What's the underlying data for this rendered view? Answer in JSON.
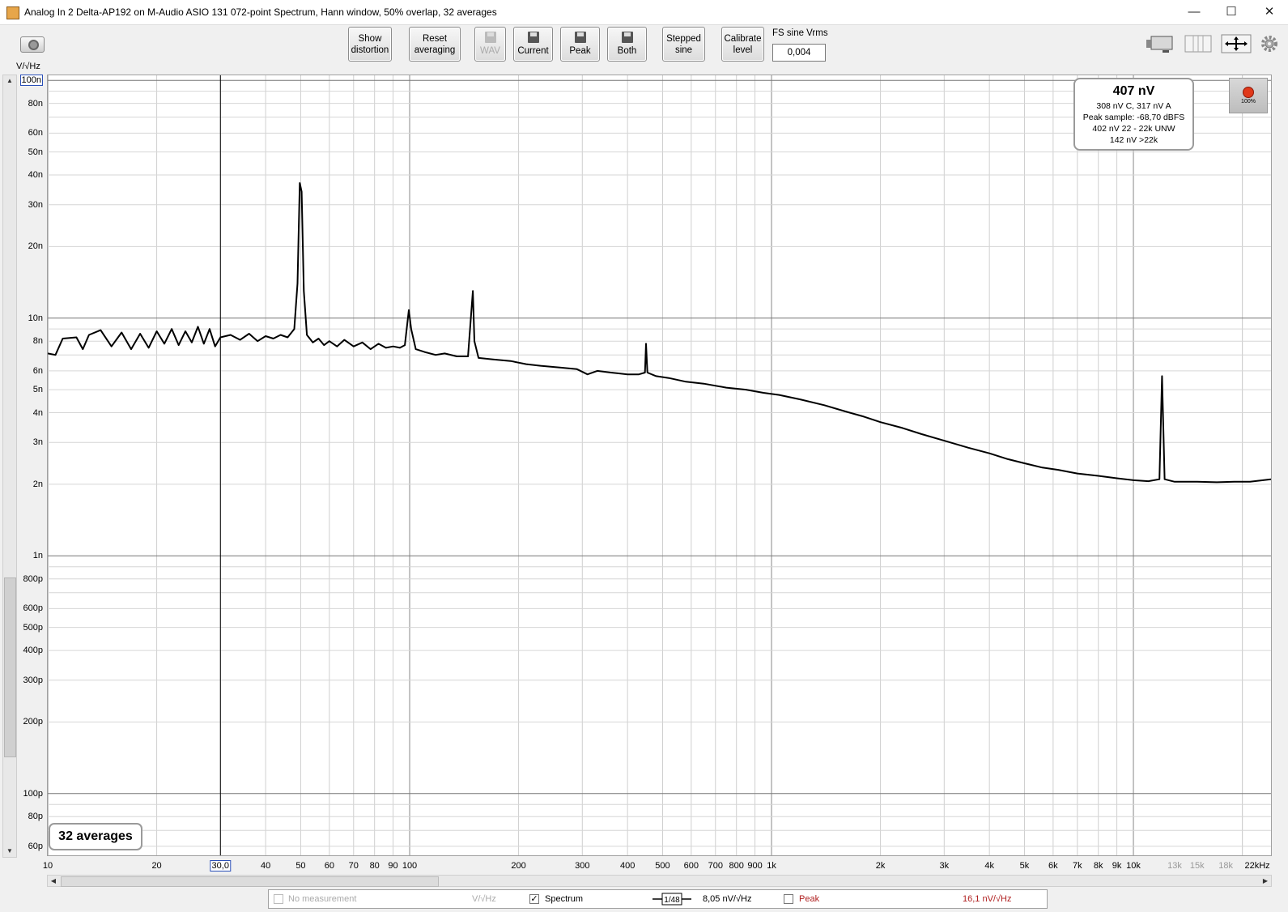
{
  "window": {
    "title": "Analog In 2 Delta-AP192 on M-Audio ASIO 131 072-point Spectrum, Hann window, 50% overlap, 32 averages",
    "minimize": "—",
    "maximize": "☐",
    "close": "✕"
  },
  "toolbar": {
    "show_distortion": [
      "Show",
      "distortion"
    ],
    "reset_averaging": [
      "Reset",
      "averaging"
    ],
    "wav": "WAV",
    "current": "Current",
    "peak": "Peak",
    "both": "Both",
    "stepped_sine": [
      "Stepped",
      "sine"
    ],
    "calibrate_level": [
      "Calibrate",
      "level"
    ],
    "fs_label": "FS sine Vrms",
    "fs_value": "0,004"
  },
  "y_unit": "V/√Hz",
  "info_box": {
    "main": "407 nV",
    "line1": "308 nV C, 317 nV A",
    "line2": "Peak sample: -68,70 dBFS",
    "line3": "402 nV 22 - 22k UNW",
    "line4": "142 nV >22k"
  },
  "indicator": {
    "percent": "100%",
    "color": "#e0391a"
  },
  "averages_badge": "32 averages",
  "legend": {
    "no_measurement": "No measurement",
    "no_measurement_unit": "V/√Hz",
    "spectrum_label": "Spectrum",
    "spectrum_checked": true,
    "smoothing": "1/48",
    "spectrum_value": "8,05 nV/√Hz",
    "peak_label": "Peak",
    "peak_checked": false,
    "peak_value": "16,1 nV/√Hz"
  },
  "chart_data": {
    "type": "line",
    "x_scale": "log",
    "y_scale": "log",
    "xlim": [
      10,
      24000
    ],
    "ylim": [
      5.5e-11,
      1.05e-07
    ],
    "ylabel": "V/√Hz",
    "grid": true,
    "cursor_x": 30,
    "cursor_x_label": "30,0",
    "y_ticks": [
      {
        "v": 1e-07,
        "label": "100n",
        "boxed": true
      },
      {
        "v": 8e-08,
        "label": "80n"
      },
      {
        "v": 6e-08,
        "label": "60n"
      },
      {
        "v": 5e-08,
        "label": "50n"
      },
      {
        "v": 4e-08,
        "label": "40n"
      },
      {
        "v": 3e-08,
        "label": "30n"
      },
      {
        "v": 2e-08,
        "label": "20n"
      },
      {
        "v": 1e-08,
        "label": "10n"
      },
      {
        "v": 8e-09,
        "label": "8n"
      },
      {
        "v": 6e-09,
        "label": "6n"
      },
      {
        "v": 5e-09,
        "label": "5n"
      },
      {
        "v": 4e-09,
        "label": "4n"
      },
      {
        "v": 3e-09,
        "label": "3n"
      },
      {
        "v": 2e-09,
        "label": "2n"
      },
      {
        "v": 1e-09,
        "label": "1n"
      },
      {
        "v": 8e-10,
        "label": "800p"
      },
      {
        "v": 6e-10,
        "label": "600p"
      },
      {
        "v": 5e-10,
        "label": "500p"
      },
      {
        "v": 4e-10,
        "label": "400p"
      },
      {
        "v": 3e-10,
        "label": "300p"
      },
      {
        "v": 2e-10,
        "label": "200p"
      },
      {
        "v": 1e-10,
        "label": "100p"
      },
      {
        "v": 8e-11,
        "label": "80p"
      },
      {
        "v": 6e-11,
        "label": "60p"
      }
    ],
    "x_ticks": [
      {
        "v": 10,
        "label": "10"
      },
      {
        "v": 20,
        "label": "20"
      },
      {
        "v": 30,
        "label": "30,0",
        "boxed": true
      },
      {
        "v": 40,
        "label": "40"
      },
      {
        "v": 50,
        "label": "50"
      },
      {
        "v": 60,
        "label": "60"
      },
      {
        "v": 70,
        "label": "70"
      },
      {
        "v": 80,
        "label": "80"
      },
      {
        "v": 90,
        "label": "90"
      },
      {
        "v": 100,
        "label": "100"
      },
      {
        "v": 200,
        "label": "200"
      },
      {
        "v": 300,
        "label": "300"
      },
      {
        "v": 400,
        "label": "400"
      },
      {
        "v": 500,
        "label": "500"
      },
      {
        "v": 600,
        "label": "600"
      },
      {
        "v": 700,
        "label": "700"
      },
      {
        "v": 800,
        "label": "800"
      },
      {
        "v": 900,
        "label": "900"
      },
      {
        "v": 1000,
        "label": "1k"
      },
      {
        "v": 2000,
        "label": "2k"
      },
      {
        "v": 3000,
        "label": "3k"
      },
      {
        "v": 4000,
        "label": "4k"
      },
      {
        "v": 5000,
        "label": "5k"
      },
      {
        "v": 6000,
        "label": "6k"
      },
      {
        "v": 7000,
        "label": "7k"
      },
      {
        "v": 8000,
        "label": "8k"
      },
      {
        "v": 9000,
        "label": "9k"
      },
      {
        "v": 10000,
        "label": "10k"
      },
      {
        "v": 13000,
        "label": "13k",
        "grey": true
      },
      {
        "v": 15000,
        "label": "15k",
        "grey": true
      },
      {
        "v": 18000,
        "label": "18k",
        "grey": true
      },
      {
        "v": 22000,
        "label": "22kHz"
      }
    ],
    "series": [
      {
        "color": "#000000",
        "points": [
          [
            10,
            7.1e-09
          ],
          [
            10.5,
            7e-09
          ],
          [
            11,
            8.2e-09
          ],
          [
            12,
            8.3e-09
          ],
          [
            12.5,
            7.4e-09
          ],
          [
            13,
            8.5e-09
          ],
          [
            14,
            8.9e-09
          ],
          [
            15,
            7.6e-09
          ],
          [
            16,
            8.7e-09
          ],
          [
            17,
            7.4e-09
          ],
          [
            18,
            8.6e-09
          ],
          [
            19,
            7.5e-09
          ],
          [
            20,
            8.8e-09
          ],
          [
            21,
            7.8e-09
          ],
          [
            22,
            9e-09
          ],
          [
            23,
            7.7e-09
          ],
          [
            24,
            8.8e-09
          ],
          [
            25,
            7.9e-09
          ],
          [
            26,
            9.2e-09
          ],
          [
            27,
            7.8e-09
          ],
          [
            28,
            9e-09
          ],
          [
            29,
            7.6e-09
          ],
          [
            30,
            8.3e-09
          ],
          [
            32,
            8.5e-09
          ],
          [
            34,
            8.1e-09
          ],
          [
            36,
            8.6e-09
          ],
          [
            38,
            8e-09
          ],
          [
            40,
            8.4e-09
          ],
          [
            42,
            8.2e-09
          ],
          [
            44,
            8.5e-09
          ],
          [
            46,
            8.3e-09
          ],
          [
            48,
            9e-09
          ],
          [
            49,
            1.4e-08
          ],
          [
            49.7,
            3.7e-08
          ],
          [
            50.3,
            3.4e-08
          ],
          [
            51,
            1.3e-08
          ],
          [
            52,
            8.5e-09
          ],
          [
            54,
            7.9e-09
          ],
          [
            56,
            8.2e-09
          ],
          [
            58,
            7.7e-09
          ],
          [
            60,
            8e-09
          ],
          [
            63,
            7.6e-09
          ],
          [
            66,
            8.1e-09
          ],
          [
            70,
            7.6e-09
          ],
          [
            74,
            7.9e-09
          ],
          [
            78,
            7.4e-09
          ],
          [
            82,
            7.8e-09
          ],
          [
            86,
            7.5e-09
          ],
          [
            90,
            7.6e-09
          ],
          [
            94,
            7.5e-09
          ],
          [
            97,
            7.7e-09
          ],
          [
            99.5,
            1.08e-08
          ],
          [
            101,
            9e-09
          ],
          [
            104,
            7.4e-09
          ],
          [
            110,
            7.2e-09
          ],
          [
            118,
            7e-09
          ],
          [
            125,
            7.1e-09
          ],
          [
            135,
            6.9e-09
          ],
          [
            145,
            6.9e-09
          ],
          [
            149.5,
            1.3e-08
          ],
          [
            151,
            8e-09
          ],
          [
            155,
            6.8e-09
          ],
          [
            170,
            6.7e-09
          ],
          [
            190,
            6.6e-09
          ],
          [
            210,
            6.4e-09
          ],
          [
            230,
            6.3e-09
          ],
          [
            260,
            6.2e-09
          ],
          [
            290,
            6.1e-09
          ],
          [
            310,
            5.8e-09
          ],
          [
            330,
            6e-09
          ],
          [
            360,
            5.9e-09
          ],
          [
            400,
            5.8e-09
          ],
          [
            430,
            5.8e-09
          ],
          [
            447,
            5.9e-09
          ],
          [
            450,
            7.8e-09
          ],
          [
            454,
            5.9e-09
          ],
          [
            480,
            5.7e-09
          ],
          [
            520,
            5.6e-09
          ],
          [
            580,
            5.4e-09
          ],
          [
            650,
            5.3e-09
          ],
          [
            750,
            5.1e-09
          ],
          [
            850,
            5e-09
          ],
          [
            950,
            4.85e-09
          ],
          [
            1050,
            4.75e-09
          ],
          [
            1200,
            4.55e-09
          ],
          [
            1400,
            4.3e-09
          ],
          [
            1600,
            4.05e-09
          ],
          [
            1800,
            3.85e-09
          ],
          [
            2000,
            3.65e-09
          ],
          [
            2300,
            3.45e-09
          ],
          [
            2600,
            3.25e-09
          ],
          [
            3000,
            3.05e-09
          ],
          [
            3500,
            2.85e-09
          ],
          [
            4000,
            2.7e-09
          ],
          [
            4500,
            2.55e-09
          ],
          [
            5000,
            2.45e-09
          ],
          [
            5600,
            2.35e-09
          ],
          [
            6200,
            2.3e-09
          ],
          [
            7000,
            2.22e-09
          ],
          [
            8000,
            2.17e-09
          ],
          [
            9000,
            2.12e-09
          ],
          [
            10000,
            2.08e-09
          ],
          [
            11000,
            2.06e-09
          ],
          [
            11800,
            2.1e-09
          ],
          [
            12000,
            5.7e-09
          ],
          [
            12200,
            2.1e-09
          ],
          [
            13000,
            2.05e-09
          ],
          [
            15000,
            2.05e-09
          ],
          [
            17000,
            2.04e-09
          ],
          [
            19000,
            2.05e-09
          ],
          [
            21000,
            2.05e-09
          ],
          [
            24000,
            2.1e-09
          ]
        ]
      }
    ]
  }
}
